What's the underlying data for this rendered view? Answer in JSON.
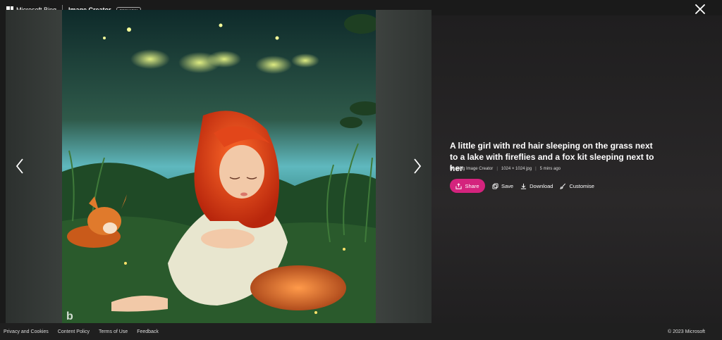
{
  "header": {
    "brand": "Microsoft Bing",
    "product": "Image Creator",
    "badge": "PREVIEW"
  },
  "image": {
    "title": "A little girl with red hair sleeping on the grass next to a lake with fireflies and a fox kit sleeping next to her",
    "source": "Bing Image Creator",
    "dimensions": "1024 × 1024 jpg",
    "age": "5 mins ago",
    "watermark": "b"
  },
  "actions": {
    "share": "Share",
    "save": "Save",
    "download": "Download",
    "customise": "Customise"
  },
  "footer": {
    "links": [
      "Privacy and Cookies",
      "Content Policy",
      "Terms of Use",
      "Feedback"
    ],
    "copyright": "© 2023 Microsoft"
  },
  "colors": {
    "accent": "#d4237d",
    "background": "#1a1a1a"
  }
}
